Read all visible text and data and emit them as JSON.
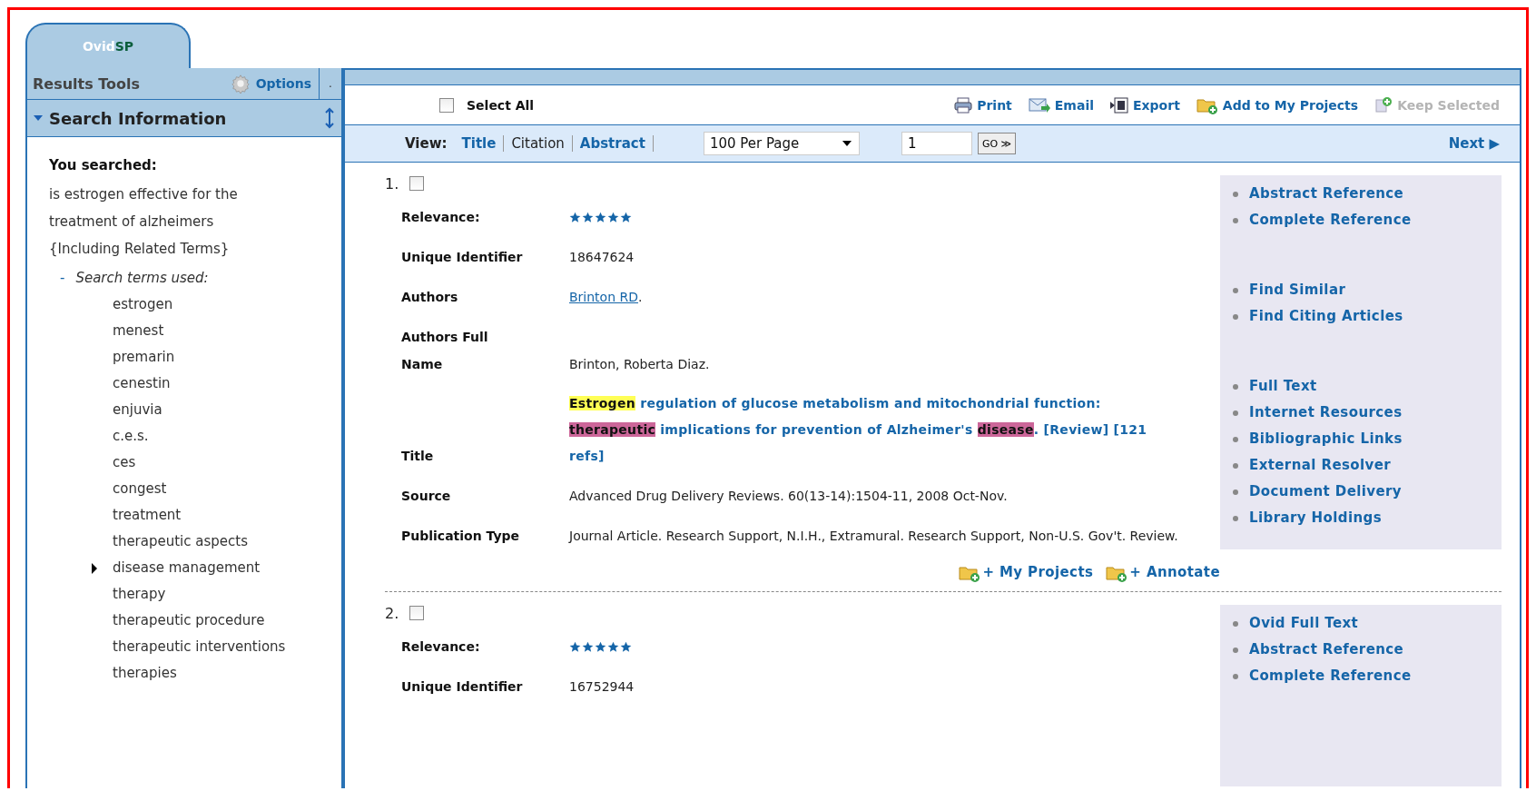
{
  "tab": {
    "prefix": "Ovid",
    "suffix": "SP",
    "selected": true
  },
  "sidebar": {
    "header": "Results Tools",
    "options": "Options",
    "narrow_label": ".",
    "section": {
      "title": "Search Information",
      "expanded": true
    },
    "searched_label": "You searched:",
    "query": "is estrogen effective for the treatment of alzheimers {Including Related Terms}",
    "terms_heading": {
      "toggle": "-",
      "label": "Search terms used:"
    },
    "terms": [
      {
        "text": "estrogen",
        "kind": "term"
      },
      {
        "text": "menest",
        "kind": "term"
      },
      {
        "text": "premarin",
        "kind": "term"
      },
      {
        "text": "cenestin",
        "kind": "term"
      },
      {
        "text": "enjuvia",
        "kind": "term"
      },
      {
        "text": "c.e.s.",
        "kind": "term"
      },
      {
        "text": "ces",
        "kind": "term"
      },
      {
        "text": "congest",
        "kind": "term"
      },
      {
        "text": "treatment",
        "kind": "term"
      },
      {
        "text": "therapeutic aspects",
        "kind": "term"
      },
      {
        "text": "disease management",
        "kind": "group",
        "expanded": false
      },
      {
        "text": "therapy",
        "kind": "term"
      },
      {
        "text": "therapeutic procedure",
        "kind": "term"
      },
      {
        "text": "therapeutic interventions",
        "kind": "term"
      },
      {
        "text": "therapies",
        "kind": "term"
      }
    ]
  },
  "toolbar": {
    "select_all": {
      "label": "Select All",
      "checked": false
    },
    "actions": [
      {
        "label": "Print",
        "kind": "print",
        "disabled": false
      },
      {
        "label": "Email",
        "kind": "email",
        "disabled": false
      },
      {
        "label": "Export",
        "kind": "export",
        "disabled": false
      },
      {
        "label": "Add to My Projects",
        "kind": "folder",
        "disabled": false
      },
      {
        "label": "Keep Selected",
        "kind": "keep",
        "disabled": true
      }
    ]
  },
  "view_bar": {
    "label": "View:",
    "views": [
      {
        "label": "Title",
        "selected": false
      },
      {
        "label": "Citation",
        "selected": true
      },
      {
        "label": "Abstract",
        "selected": false
      }
    ],
    "per_page": "100 Per Page",
    "page": "1",
    "go": "GO ≫",
    "next": "Next ▶"
  },
  "results": [
    {
      "number": "1.",
      "checked": false,
      "stars": 5,
      "fields": [
        {
          "kind": "text",
          "label": "Unique Identifier",
          "value": "18647624"
        },
        {
          "kind": "author",
          "label": "Authors",
          "link": "Brinton RD",
          "suffix": "."
        },
        {
          "kind": "text",
          "label": "Authors Full Name",
          "value": "Brinton, Roberta Diaz."
        },
        {
          "kind": "title",
          "label": "Title",
          "segments": [
            {
              "text": "Estrogen",
              "color": "#ffff55"
            },
            {
              "text": " regulation of glucose metabolism and mitochondrial function: "
            },
            {
              "text": "therapeutic",
              "color": "#cc6699"
            },
            {
              "text": " implications for prevention of Alzheimer's "
            },
            {
              "text": "disease",
              "color": "#cc6699"
            },
            {
              "text": ". [Review] [121 refs]"
            }
          ]
        },
        {
          "kind": "text",
          "label": "Source",
          "value": "Advanced Drug Delivery Reviews. 60(13-14):1504-11, 2008 Oct-Nov."
        },
        {
          "kind": "text",
          "label": "Publication Type",
          "value": "Journal Article. Research Support, N.I.H., Extramural. Research Support, Non-U.S. Gov't. Review."
        }
      ],
      "relevance_label": "Relevance:",
      "actions": [
        "+ My Projects",
        "+ Annotate"
      ],
      "link_groups": [
        [
          "Abstract Reference",
          "Complete Reference"
        ],
        [
          "Find Similar",
          "Find Citing Articles"
        ],
        [
          "Full Text",
          "Internet Resources",
          "Bibliographic Links",
          "External Resolver",
          "Document Delivery",
          "Library Holdings"
        ]
      ]
    },
    {
      "number": "2.",
      "checked": false,
      "stars": 5,
      "fields": [
        {
          "kind": "text",
          "label": "Unique Identifier",
          "value": "16752944"
        }
      ],
      "relevance_label": "Relevance:",
      "link_groups": [
        [
          "Ovid Full Text",
          "Abstract Reference",
          "Complete Reference"
        ]
      ]
    }
  ]
}
